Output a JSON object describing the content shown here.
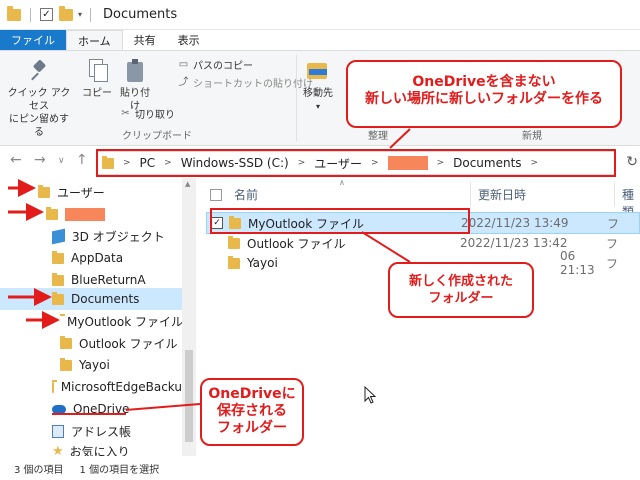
{
  "titlebar": {
    "title": "Documents"
  },
  "ribbon_tabs": [
    "ファイル",
    "ホーム",
    "共有",
    "表示"
  ],
  "ribbon": {
    "pin_label_1": "クイック アクセス",
    "pin_label_2": "にピン留めする",
    "copy_label": "コピー",
    "paste_label": "貼り付け",
    "copy_path": "パスのコピー",
    "paste_shortcut": "ショートカットの貼り付け",
    "cut": "切り取り",
    "clipboard_group": "クリップボード",
    "move_to": "移動先",
    "organize_group": "整理",
    "new_group": "新規"
  },
  "address": {
    "pc": "PC",
    "drive": "Windows-SSD (C:)",
    "users": "ユーザー",
    "current": "Documents"
  },
  "nav": {
    "items": [
      "ユーザー",
      "3D オブジェクト",
      "AppData",
      "BlueReturnA",
      "Documents",
      "MyOutlook ファイル",
      "Outlook ファイル",
      "Yayoi",
      "MicrosoftEdgeBacku",
      "OneDrive",
      "アドレス帳",
      "お気に入り"
    ]
  },
  "columns": {
    "name": "名前",
    "date": "更新日時",
    "type": "種類"
  },
  "files": [
    {
      "name": "MyOutlook ファイル",
      "date": "2022/11/23 13:49",
      "type": "フ"
    },
    {
      "name": "Outlook ファイル",
      "date": "2022/11/23 13:42",
      "type": "フ"
    },
    {
      "name": "Yayoi",
      "date": "06 21:13",
      "type": "フ"
    }
  ],
  "status": {
    "count": "3 個の項目",
    "selected": "1 個の項目を選択"
  },
  "annotations": {
    "callout_top_1": "OneDriveを含まない",
    "callout_top_2": "新しい場所に新しいフォルダーを作る",
    "callout_mid_1": "新しく作成された",
    "callout_mid_2": "フォルダー",
    "callout_bot_1": "OneDriveに",
    "callout_bot_2": "保存される",
    "callout_bot_3": "フォルダー"
  },
  "colors": {
    "annotation": "#e21b1b",
    "selection": "#cce8ff",
    "folder": "#e8b94a",
    "file_tab": "#1979ca",
    "redaction": "#f7875a"
  }
}
